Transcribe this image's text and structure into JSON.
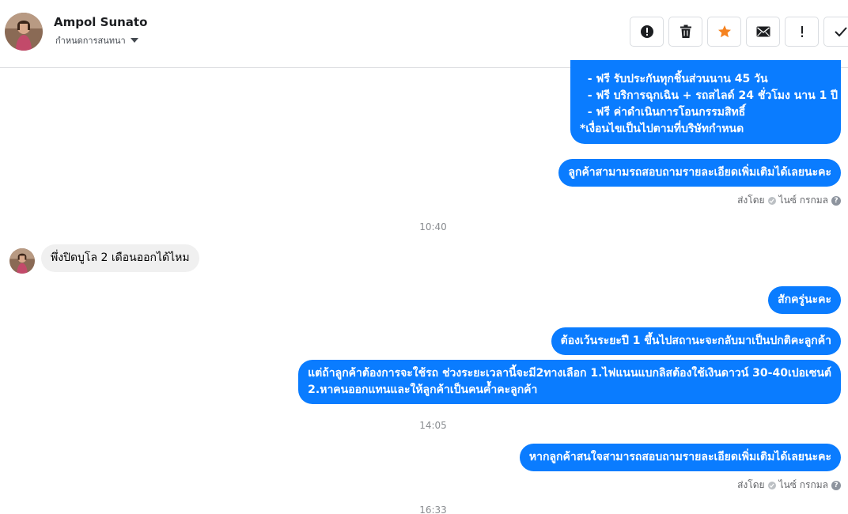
{
  "header": {
    "contact_name": "Ampol Sunato",
    "assign_label": "กำหนดการสนทนา",
    "actions": [
      {
        "icon": "alert-circle-icon",
        "label": "Mark as spam"
      },
      {
        "icon": "trash-icon",
        "label": "Delete"
      },
      {
        "icon": "star-icon",
        "label": "Star"
      },
      {
        "icon": "mail-icon",
        "label": "Mark as unread"
      },
      {
        "icon": "exclamation-icon",
        "label": "Follow up"
      },
      {
        "icon": "check-icon",
        "label": "Done"
      }
    ]
  },
  "colors": {
    "outgoing_bubble": "#0a7cff",
    "incoming_bubble": "#f0f0f0",
    "star": "#f5821f"
  },
  "messages": {
    "m1": {
      "lines": [
        "  - ฟรี รับประกันทุกชิ้นส่วนนาน 45 วัน",
        "  - ฟรี บริการฉุกเฉิน + รถสไลด์ 24 ชั่วโมง นาน 1 ปี",
        "  - ฟรี ค่าดำเนินการโอนกรรมสิทธิ์",
        "*เงื่อนไขเป็นไปตามที่บริษัทกำหนด"
      ]
    },
    "m2": {
      "text": "ลูกค้าสามามรถสอบถามรายละเอียดเพิ่มเติมได้เลยนะคะ"
    },
    "status1": {
      "sent_by": "ส่งโดย",
      "agent": "ไนซ์ กรกมล"
    },
    "time1": "10:40",
    "m3": {
      "text": "พึ่งปิดบูโล 2 เดือนออกได้ไหม"
    },
    "m4": {
      "text": "สักครู่นะคะ"
    },
    "m5": {
      "text": "ต้องเว้นระยะปี 1 ขึ้นไปสถานะจะกลับมาเป็นปกติคะลูกค้า"
    },
    "m6": {
      "lines": [
        "แต่ถ้าลูกค้าต้องการจะใช้รถ ช่วงระยะเวลานี้จะมี2ทางเลือก 1.ไฟแนนแบกลิสต้องใช้เงินดาวน์ 30-40เปอเซนต์",
        "2.หาคนออกแทนและให้ลูกค้าเป็นคนค้ำคะลูกค้า"
      ]
    },
    "time2": "14:05",
    "m7": {
      "text": "หากลูกค้าสนใจสามารถสอบถามรายละเอียดเพิ่มเติมได้เลยนะคะ"
    },
    "status2": {
      "sent_by": "ส่งโดย",
      "agent": "ไนซ์ กรกมล"
    },
    "time3": "16:33"
  }
}
